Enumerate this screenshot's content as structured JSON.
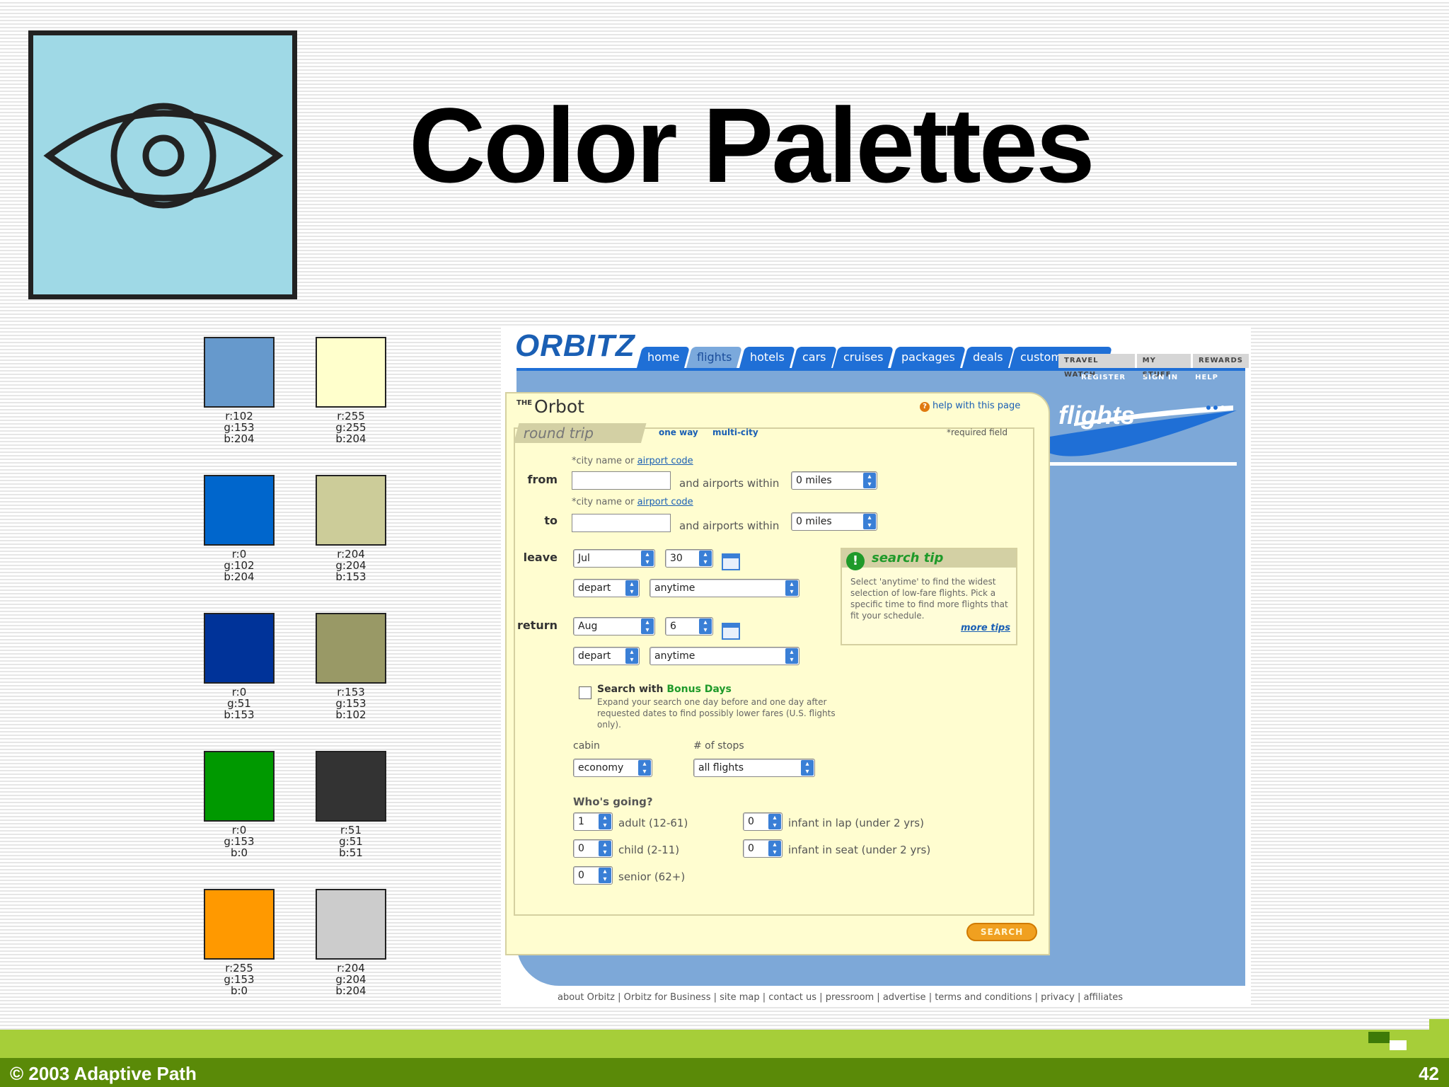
{
  "slide": {
    "title": "Color Palettes",
    "copyright": "© 2003 Adaptive Path",
    "page_number": "42"
  },
  "logo_icon": "eye-icon",
  "swatches": [
    {
      "color": "#6699cc",
      "r": "r:102",
      "g": "g:153",
      "b": "b:204"
    },
    {
      "color": "#ffffcc",
      "r": "r:255",
      "g": "g:255",
      "b": "b:204"
    },
    {
      "color": "#0066cc",
      "r": "r:0",
      "g": "g:102",
      "b": "b:204"
    },
    {
      "color": "#cccc99",
      "r": "r:204",
      "g": "g:204",
      "b": "b:153"
    },
    {
      "color": "#003399",
      "r": "r:0",
      "g": "g:51",
      "b": "b:153"
    },
    {
      "color": "#999966",
      "r": "r:153",
      "g": "g:153",
      "b": "b:102"
    },
    {
      "color": "#009900",
      "r": "r:0",
      "g": "g:153",
      "b": "b:0"
    },
    {
      "color": "#333333",
      "r": "r:51",
      "g": "g:51",
      "b": "b:51"
    },
    {
      "color": "#ff9900",
      "r": "r:255",
      "g": "g:153",
      "b": "b:0"
    },
    {
      "color": "#cccccc",
      "r": "r:204",
      "g": "g:204",
      "b": "b:204"
    }
  ],
  "orbitz": {
    "logo": "ORBITZ",
    "tabs": [
      "home",
      "flights",
      "hotels",
      "cars",
      "cruises",
      "packages",
      "deals",
      "customer care"
    ],
    "active_tab": "flights",
    "util_tabs": [
      "TRAVEL WATCH",
      "MY STUFF",
      "REWARDS"
    ],
    "sub_links": [
      "REGISTER",
      "SIGN IN",
      "HELP"
    ],
    "banner_text": "flights",
    "form": {
      "title_prefix": "THE",
      "title": "Orbot",
      "help": "help with this page",
      "trip_tab": "round trip",
      "one_way": "one way",
      "multi_city": "multi-city",
      "required": "*required field",
      "hint_prefix": "*city name or ",
      "hint_link": "airport code",
      "from_label": "from",
      "to_label": "to",
      "within_text": "and airports within",
      "miles": "0 miles",
      "leave_label": "leave",
      "leave_month": "Jul",
      "leave_day": "30",
      "depart": "depart",
      "anytime": "anytime",
      "return_label": "return",
      "return_month": "Aug",
      "return_day": "6",
      "tip_title": "search tip",
      "tip_text": "Select 'anytime' to find the widest selection of low-fare flights. Pick a specific time to find more flights that fit your schedule.",
      "tip_more": "more tips",
      "bonus_prefix": "Search with ",
      "bonus_bold": "Bonus Days",
      "bonus_text": "Expand your search one day before and one day after requested dates to find possibly lower fares (U.S. flights only).",
      "cabin_label": "cabin",
      "cabin_value": "economy",
      "stops_label": "# of stops",
      "stops_value": "all flights",
      "going_label": "Who's going?",
      "adult_count": "1",
      "adult_label": "adult (12-61)",
      "child_count": "0",
      "child_label": "child (2-11)",
      "senior_count": "0",
      "senior_label": "senior (62+)",
      "infant_lap_count": "0",
      "infant_lap_label": "infant in lap (under 2 yrs)",
      "infant_seat_count": "0",
      "infant_seat_label": "infant in seat (under 2 yrs)",
      "search_button": "SEARCH"
    },
    "footer_links": "about Orbitz | Orbitz for Business | site map | contact us | pressroom | advertise | terms and conditions | privacy | affiliates"
  }
}
